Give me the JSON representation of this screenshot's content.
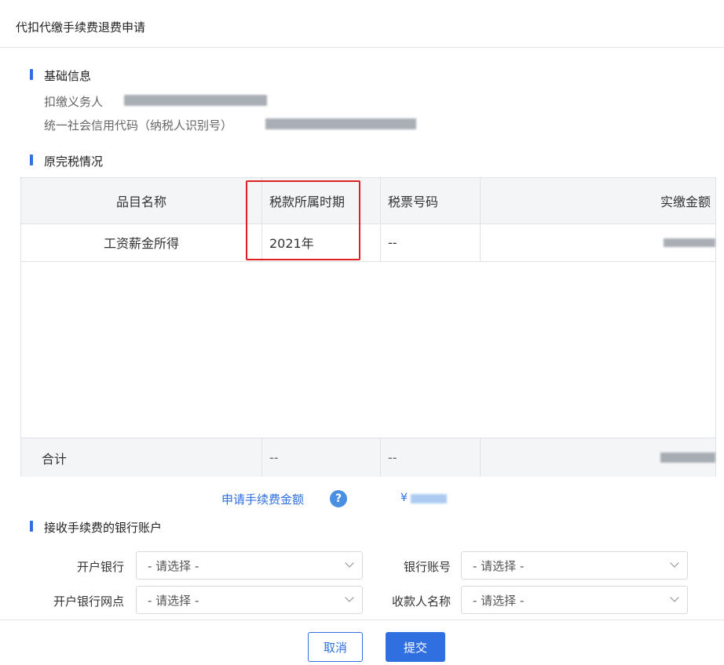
{
  "dialog": {
    "title": "代扣代缴手续费退费申请"
  },
  "basic_info": {
    "section_title": "基础信息",
    "withholding_agent_label": "扣缴义务人",
    "credit_code_label": "统一社会信用代码（纳税人识别号）"
  },
  "tax_section": {
    "section_title": "原完税情况",
    "headers": [
      "品目名称",
      "税款所属时期",
      "税票号码",
      "实缴金额"
    ],
    "rows": [
      {
        "item": "工资薪金所得",
        "period": "2021年",
        "ticket_no": "--"
      }
    ],
    "total": {
      "label": "合计",
      "period": "--",
      "ticket_no": "--"
    }
  },
  "fee": {
    "label": "申请手续费金额",
    "help_icon": "?",
    "currency": "¥"
  },
  "bank_section": {
    "section_title": "接收手续费的银行账户",
    "fields": {
      "bank_label": "开户银行",
      "bank_value": "- 请选择 -",
      "account_label": "银行账号",
      "account_value": "- 请选择 -",
      "branch_label": "开户银行网点",
      "branch_value": "- 请选择 -",
      "payee_label": "收款人名称",
      "payee_value": "- 请选择 -"
    }
  },
  "actions": {
    "cancel": "取消",
    "submit": "提交"
  },
  "colors": {
    "accent": "#2f6fe0",
    "highlight": "#e02020"
  }
}
